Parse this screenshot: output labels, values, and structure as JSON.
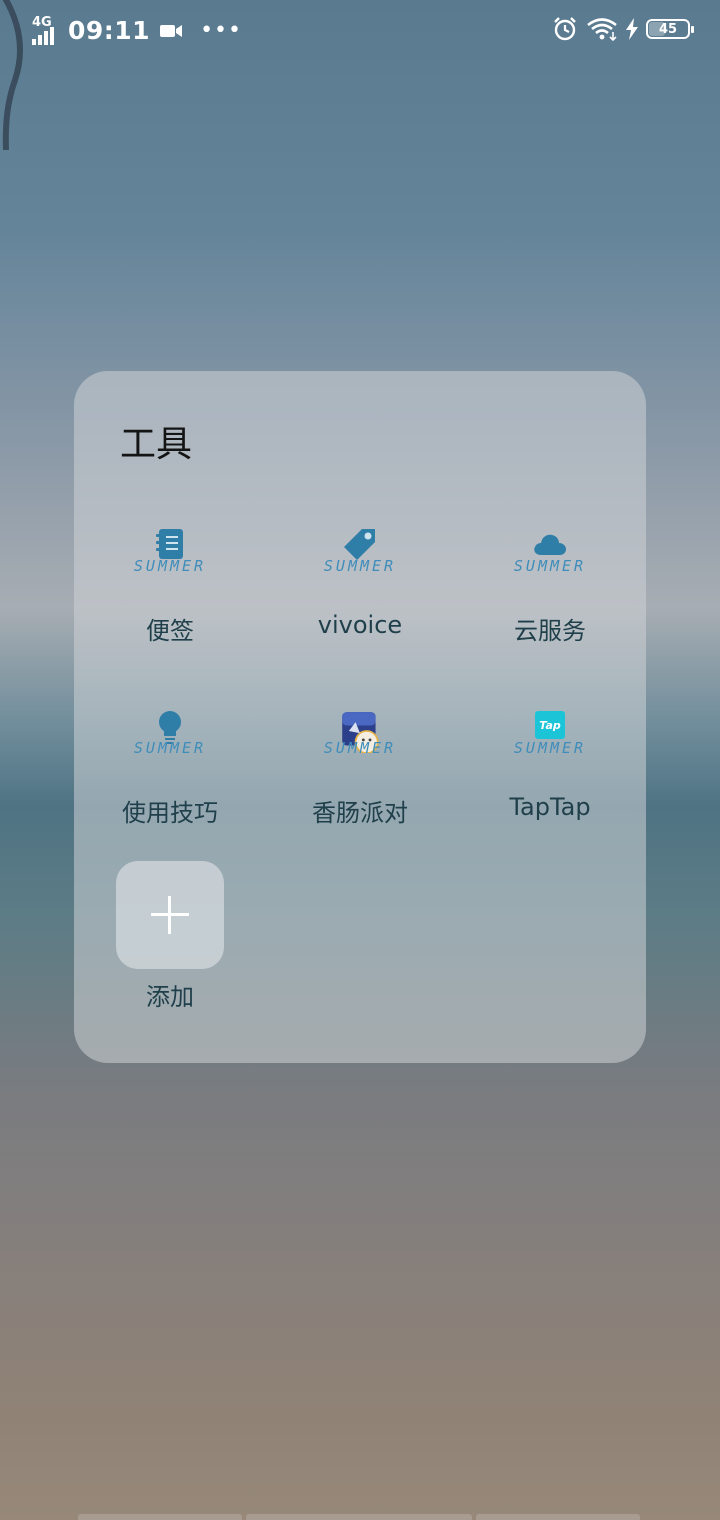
{
  "status_bar": {
    "network": "4G",
    "time": "09:11",
    "more": "•••",
    "battery": "45",
    "battery_level_percent": 45
  },
  "folder": {
    "title": "工具",
    "badge_text": "SUMMER",
    "apps": [
      {
        "label": "便签",
        "icon": "notebook-icon"
      },
      {
        "label": "vivoice",
        "icon": "tag-icon"
      },
      {
        "label": "云服务",
        "icon": "cloud-icon"
      },
      {
        "label": "使用技巧",
        "icon": "lightbulb-icon"
      },
      {
        "label": "香肠派对",
        "icon": "game-icon"
      },
      {
        "label": "TapTap",
        "icon": "taptap-icon",
        "icon_text": "Tap"
      }
    ],
    "add_label": "添加"
  },
  "colors": {
    "icon_blue": "#2f7ea8",
    "summer_text": "#3f8dba",
    "label_text": "#1f3f4a",
    "taptap_bg": "#1cc4d8"
  }
}
